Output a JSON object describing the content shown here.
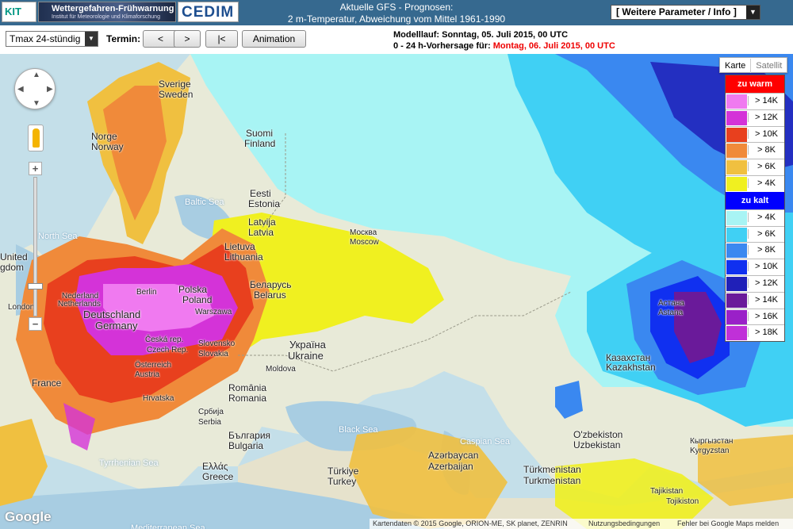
{
  "header": {
    "kit_logo": "KIT",
    "warn_title": "Wetter­gefahren-Frühwarnung",
    "warn_subtitle": "Institut für Meteorologie und Klimaforschung",
    "cedim_logo": "CEDIM",
    "title_line1": "Aktuelle GFS - Prognosen:",
    "title_line2": "2 m-Temperatur, Abweichung vom Mittel 1961-1990",
    "param_select": "[ Weitere Parameter / Info ]"
  },
  "toolbar": {
    "variable_select": "Tmax 24-stündig",
    "termin_label": "Termin:",
    "prev_label": "<",
    "next_label": ">",
    "first_label": "|<",
    "animation_label": "Animation",
    "run_text": "Modelllauf: Sonntag, 05. Juli 2015, 00 UTC",
    "forecast_prefix": "0 - 24 h-Vorhersage für: ",
    "forecast_date": "Montag, 06. Juli 2015, 00 UTC"
  },
  "map": {
    "tab_karte": "Karte",
    "tab_satellit": "Satellit",
    "zoom_in": "+",
    "zoom_out": "−",
    "google": "Google",
    "attribution_data": "Kartendaten © 2015 Google, ORION-ME, SK planet, ZENRIN",
    "attribution_terms": "Nutzungsbedingungen",
    "attribution_report": "Fehler bei Google Maps melden",
    "labels": [
      {
        "text": "Sverige",
        "cls": ""
      },
      {
        "text": "Sweden",
        "cls": ""
      },
      {
        "text": "Norge",
        "cls": ""
      },
      {
        "text": "Norway",
        "cls": ""
      },
      {
        "text": "Suomi",
        "cls": ""
      },
      {
        "text": "Finland",
        "cls": ""
      },
      {
        "text": "Baltic Sea",
        "cls": "sea"
      },
      {
        "text": "North Sea",
        "cls": "sea"
      },
      {
        "text": "Eesti",
        "cls": ""
      },
      {
        "text": "Estonia",
        "cls": ""
      },
      {
        "text": "Latvija",
        "cls": ""
      },
      {
        "text": "Latvia",
        "cls": ""
      },
      {
        "text": "Lietuva",
        "cls": ""
      },
      {
        "text": "Lithuania",
        "cls": ""
      },
      {
        "text": "Москва",
        "cls": "small"
      },
      {
        "text": "Moscow",
        "cls": "small"
      },
      {
        "text": "Беларусь",
        "cls": ""
      },
      {
        "text": "Belarus",
        "cls": ""
      },
      {
        "text": "Polska",
        "cls": ""
      },
      {
        "text": "Poland",
        "cls": ""
      },
      {
        "text": "Warszawa",
        "cls": "small"
      },
      {
        "text": "Berlin",
        "cls": "small"
      },
      {
        "text": "Deutschland",
        "cls": "big"
      },
      {
        "text": "Germany",
        "cls": "big"
      },
      {
        "text": "Nederland",
        "cls": "small"
      },
      {
        "text": "Netherlands",
        "cls": "small"
      },
      {
        "text": "United",
        "cls": ""
      },
      {
        "text": "gdom",
        "cls": ""
      },
      {
        "text": "London",
        "cls": "small"
      },
      {
        "text": "Česká rep.",
        "cls": "small"
      },
      {
        "text": "Czech Rep.",
        "cls": "small"
      },
      {
        "text": "Slovensko",
        "cls": "small"
      },
      {
        "text": "Slovakia",
        "cls": "small"
      },
      {
        "text": "Österreich",
        "cls": "small"
      },
      {
        "text": "Austria",
        "cls": "small"
      },
      {
        "text": "France",
        "cls": ""
      },
      {
        "text": "Україна",
        "cls": "big"
      },
      {
        "text": "Ukraine",
        "cls": "big"
      },
      {
        "text": "Moldova",
        "cls": "small"
      },
      {
        "text": "România",
        "cls": ""
      },
      {
        "text": "Romania",
        "cls": ""
      },
      {
        "text": "Hrvatska",
        "cls": "small"
      },
      {
        "text": "Србија",
        "cls": "small"
      },
      {
        "text": "Serbia",
        "cls": "small"
      },
      {
        "text": "България",
        "cls": ""
      },
      {
        "text": "Bulgaria",
        "cls": ""
      },
      {
        "text": "Ελλάς",
        "cls": ""
      },
      {
        "text": "Greece",
        "cls": ""
      },
      {
        "text": "Türkiye",
        "cls": ""
      },
      {
        "text": "Turkey",
        "cls": ""
      },
      {
        "text": "Black Sea",
        "cls": "sea"
      },
      {
        "text": "Caspian Sea",
        "cls": "sea"
      },
      {
        "text": "Tyrrhenian Sea",
        "cls": "sea"
      },
      {
        "text": "Mediterranean Sea",
        "cls": "sea"
      },
      {
        "text": "Azərbaycan",
        "cls": ""
      },
      {
        "text": "Azerbaijan",
        "cls": ""
      },
      {
        "text": "Türkmenistan",
        "cls": ""
      },
      {
        "text": "Turkmenistan",
        "cls": ""
      },
      {
        "text": "O'zbekiston",
        "cls": ""
      },
      {
        "text": "Uzbekistan",
        "cls": ""
      },
      {
        "text": "Казахстан",
        "cls": ""
      },
      {
        "text": "Kazakhstan",
        "cls": ""
      },
      {
        "text": "Астана",
        "cls": "small"
      },
      {
        "text": "Astana",
        "cls": "small"
      },
      {
        "text": "Кыргызстан",
        "cls": "small"
      },
      {
        "text": "Kyrgyzstan",
        "cls": "small"
      },
      {
        "text": "Tajikistan",
        "cls": "small"
      },
      {
        "text": "Tojikiston",
        "cls": "small"
      }
    ]
  },
  "legend": {
    "warm_title": "zu warm",
    "cold_title": "zu kalt",
    "warm_color": "#ff0000",
    "cold_color": "#0000ff",
    "warm": [
      {
        "label": "> 14K",
        "color": "#f07af0"
      },
      {
        "label": "> 12K",
        "color": "#d433d8"
      },
      {
        "label": "> 10K",
        "color": "#e8401e"
      },
      {
        "label": "> 8K",
        "color": "#f08a3a"
      },
      {
        "label": "> 6K",
        "color": "#f0c040"
      },
      {
        "label": "> 4K",
        "color": "#f0f020"
      }
    ],
    "cold": [
      {
        "label": "> 4K",
        "color": "#a8f4f4"
      },
      {
        "label": "> 6K",
        "color": "#40d0f4"
      },
      {
        "label": "> 8K",
        "color": "#3a88f0"
      },
      {
        "label": "> 10K",
        "color": "#1030f0"
      },
      {
        "label": "> 12K",
        "color": "#2020b8"
      },
      {
        "label": "> 14K",
        "color": "#6a1a9a"
      },
      {
        "label": "> 16K",
        "color": "#9a20c8"
      },
      {
        "label": "> 18K",
        "color": "#c030d8"
      }
    ]
  }
}
